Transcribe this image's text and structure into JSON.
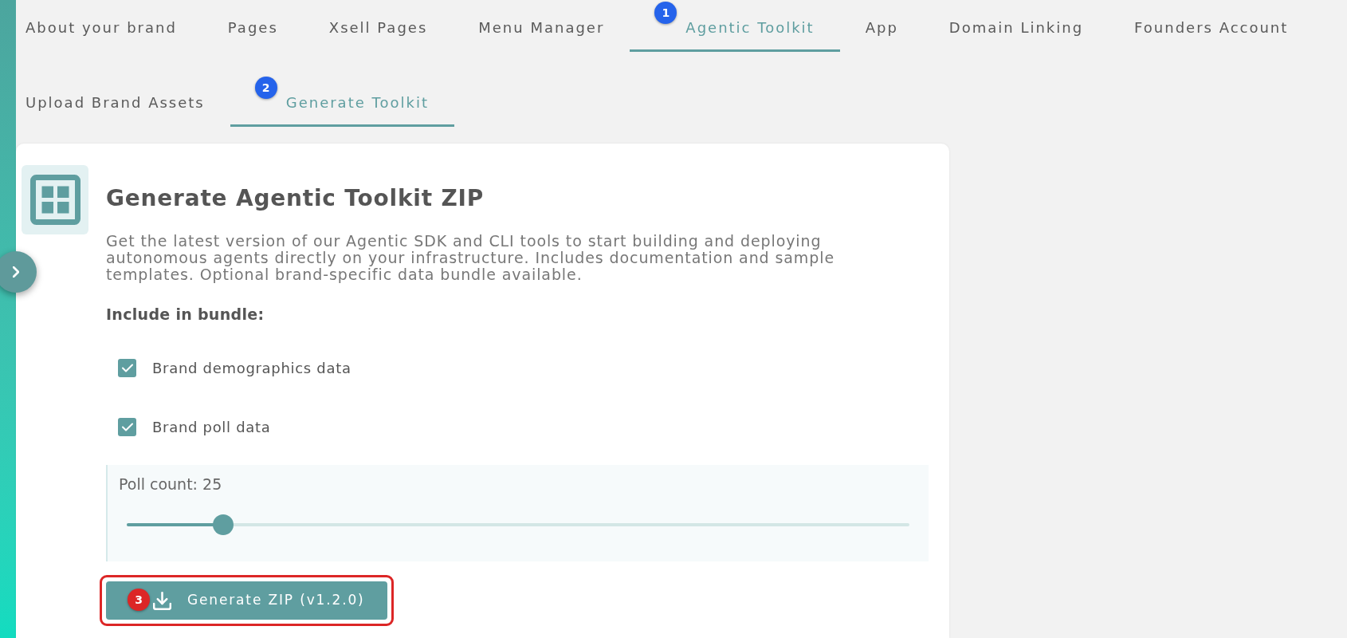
{
  "tabs": [
    {
      "label": "About your brand",
      "selected": false
    },
    {
      "label": "Pages",
      "selected": false
    },
    {
      "label": "Xsell Pages",
      "selected": false
    },
    {
      "label": "Menu Manager",
      "selected": false
    },
    {
      "label": "Agentic Toolkit",
      "selected": true,
      "step": {
        "label": "1",
        "color": "#2563eb"
      }
    },
    {
      "label": "App",
      "selected": false
    },
    {
      "label": "Domain Linking",
      "selected": false
    },
    {
      "label": "Founders Account",
      "selected": false
    }
  ],
  "subtabs": [
    {
      "label": "Upload Brand Assets",
      "selected": false
    },
    {
      "label": "Generate Toolkit",
      "selected": true,
      "step": {
        "label": "2",
        "color": "#2563eb"
      }
    }
  ],
  "card": {
    "title": "Generate Agentic Toolkit ZIP",
    "description": "Get the latest version of our Agentic SDK and CLI tools to start building and deploying autonomous agents directly on your infrastructure. Includes documentation and sample templates. Optional brand-specific data bundle available.",
    "bundle_heading": "Include in bundle:",
    "options": [
      {
        "label": "Brand demographics data",
        "checked": true
      },
      {
        "label": "Brand poll data",
        "checked": true
      }
    ],
    "poll_count": {
      "label": "Poll count: 25",
      "level": 0.123
    },
    "button": {
      "label": "Generate ZIP (v1.2.0)",
      "step": {
        "label": "3",
        "color": "#dc2626",
        "outlined": true
      }
    }
  }
}
